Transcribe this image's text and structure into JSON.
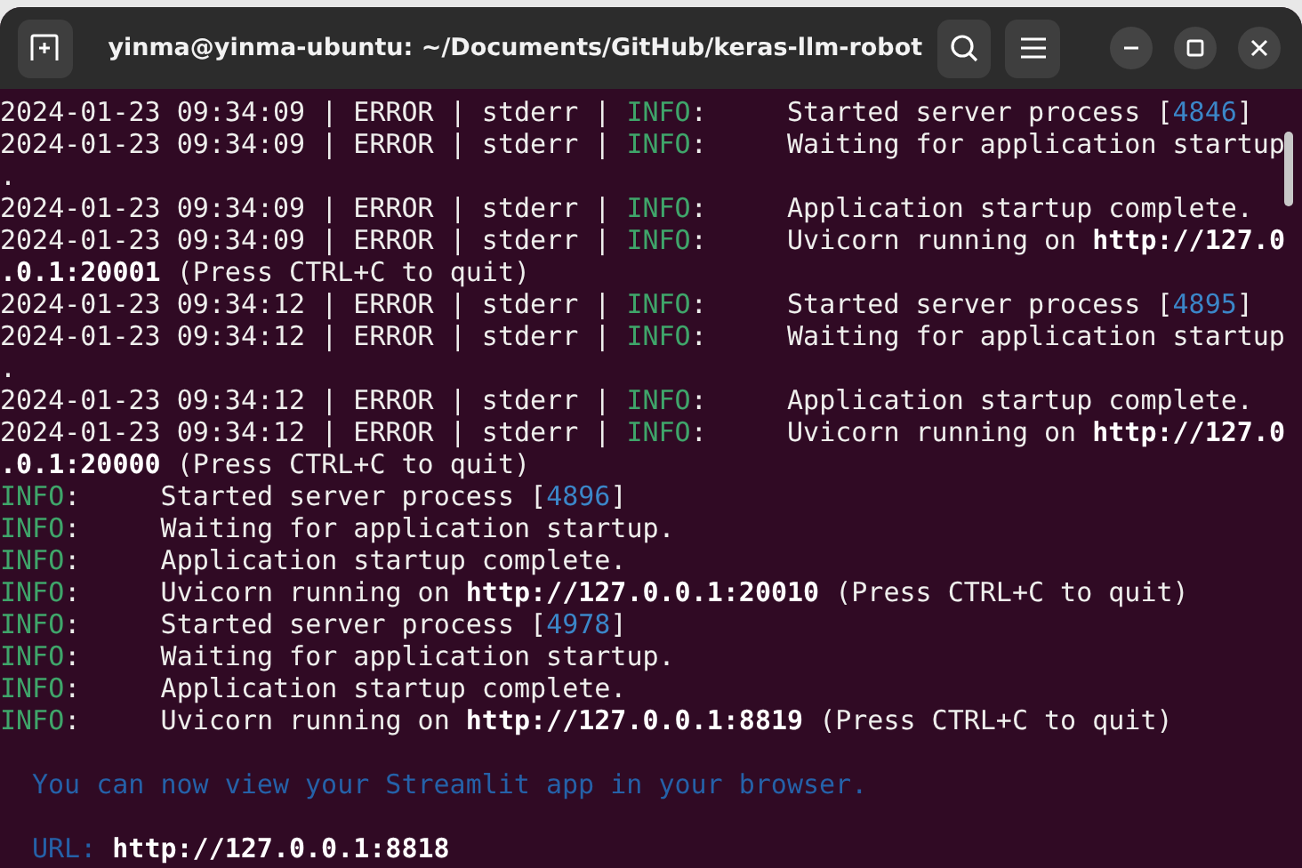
{
  "window": {
    "title": "yinma@yinma-ubuntu: ~/Documents/GitHub/keras-llm-robot"
  },
  "terminal": {
    "lines": [
      {
        "kind": "log",
        "segments": [
          {
            "kind": "text",
            "text": "2024-01-23 09:34:09 | ERROR | stderr | "
          },
          {
            "kind": "info",
            "text": "INFO"
          },
          {
            "kind": "text",
            "text": ":     Started server process ["
          },
          {
            "kind": "pid",
            "text": "4846"
          },
          {
            "kind": "text",
            "text": "]"
          }
        ]
      },
      {
        "kind": "log",
        "segments": [
          {
            "kind": "text",
            "text": "2024-01-23 09:34:09 | ERROR | stderr | "
          },
          {
            "kind": "info",
            "text": "INFO"
          },
          {
            "kind": "text",
            "text": ":     Waiting for application startup"
          }
        ]
      },
      {
        "kind": "log",
        "segments": [
          {
            "kind": "text",
            "text": "."
          }
        ]
      },
      {
        "kind": "log",
        "segments": [
          {
            "kind": "text",
            "text": "2024-01-23 09:34:09 | ERROR | stderr | "
          },
          {
            "kind": "info",
            "text": "INFO"
          },
          {
            "kind": "text",
            "text": ":     Application startup complete."
          }
        ]
      },
      {
        "kind": "log",
        "segments": [
          {
            "kind": "text",
            "text": "2024-01-23 09:34:09 | ERROR | stderr | "
          },
          {
            "kind": "info",
            "text": "INFO"
          },
          {
            "kind": "text",
            "text": ":     Uvicorn running on "
          },
          {
            "kind": "bold",
            "text": "http://127.0"
          }
        ]
      },
      {
        "kind": "log",
        "segments": [
          {
            "kind": "bold",
            "text": ".0.1:20001"
          },
          {
            "kind": "text",
            "text": " (Press CTRL+C to quit)"
          }
        ]
      },
      {
        "kind": "log",
        "segments": [
          {
            "kind": "text",
            "text": "2024-01-23 09:34:12 | ERROR | stderr | "
          },
          {
            "kind": "info",
            "text": "INFO"
          },
          {
            "kind": "text",
            "text": ":     Started server process ["
          },
          {
            "kind": "pid",
            "text": "4895"
          },
          {
            "kind": "text",
            "text": "]"
          }
        ]
      },
      {
        "kind": "log",
        "segments": [
          {
            "kind": "text",
            "text": "2024-01-23 09:34:12 | ERROR | stderr | "
          },
          {
            "kind": "info",
            "text": "INFO"
          },
          {
            "kind": "text",
            "text": ":     Waiting for application startup"
          }
        ]
      },
      {
        "kind": "log",
        "segments": [
          {
            "kind": "text",
            "text": "."
          }
        ]
      },
      {
        "kind": "log",
        "segments": [
          {
            "kind": "text",
            "text": "2024-01-23 09:34:12 | ERROR | stderr | "
          },
          {
            "kind": "info",
            "text": "INFO"
          },
          {
            "kind": "text",
            "text": ":     Application startup complete."
          }
        ]
      },
      {
        "kind": "log",
        "segments": [
          {
            "kind": "text",
            "text": "2024-01-23 09:34:12 | ERROR | stderr | "
          },
          {
            "kind": "info",
            "text": "INFO"
          },
          {
            "kind": "text",
            "text": ":     Uvicorn running on "
          },
          {
            "kind": "bold",
            "text": "http://127.0"
          }
        ]
      },
      {
        "kind": "log",
        "segments": [
          {
            "kind": "bold",
            "text": ".0.1:20000"
          },
          {
            "kind": "text",
            "text": " (Press CTRL+C to quit)"
          }
        ]
      },
      {
        "kind": "log",
        "segments": [
          {
            "kind": "info",
            "text": "INFO"
          },
          {
            "kind": "text",
            "text": ":     Started server process ["
          },
          {
            "kind": "pid",
            "text": "4896"
          },
          {
            "kind": "text",
            "text": "]"
          }
        ]
      },
      {
        "kind": "log",
        "segments": [
          {
            "kind": "info",
            "text": "INFO"
          },
          {
            "kind": "text",
            "text": ":     Waiting for application startup."
          }
        ]
      },
      {
        "kind": "log",
        "segments": [
          {
            "kind": "info",
            "text": "INFO"
          },
          {
            "kind": "text",
            "text": ":     Application startup complete."
          }
        ]
      },
      {
        "kind": "log",
        "segments": [
          {
            "kind": "info",
            "text": "INFO"
          },
          {
            "kind": "text",
            "text": ":     Uvicorn running on "
          },
          {
            "kind": "bold",
            "text": "http://127.0.0.1:20010"
          },
          {
            "kind": "text",
            "text": " (Press CTRL+C to quit)"
          }
        ]
      },
      {
        "kind": "log",
        "segments": [
          {
            "kind": "info",
            "text": "INFO"
          },
          {
            "kind": "text",
            "text": ":     Started server process ["
          },
          {
            "kind": "pid",
            "text": "4978"
          },
          {
            "kind": "text",
            "text": "]"
          }
        ]
      },
      {
        "kind": "log",
        "segments": [
          {
            "kind": "info",
            "text": "INFO"
          },
          {
            "kind": "text",
            "text": ":     Waiting for application startup."
          }
        ]
      },
      {
        "kind": "log",
        "segments": [
          {
            "kind": "info",
            "text": "INFO"
          },
          {
            "kind": "text",
            "text": ":     Application startup complete."
          }
        ]
      },
      {
        "kind": "log",
        "segments": [
          {
            "kind": "info",
            "text": "INFO"
          },
          {
            "kind": "text",
            "text": ":     Uvicorn running on "
          },
          {
            "kind": "bold",
            "text": "http://127.0.0.1:8819"
          },
          {
            "kind": "text",
            "text": " (Press CTRL+C to quit)"
          }
        ]
      },
      {
        "kind": "notice",
        "segments": [
          {
            "kind": "notice",
            "text": "You can now view your Streamlit app in your browser."
          }
        ]
      },
      {
        "kind": "notice",
        "segments": [
          {
            "kind": "label",
            "text": "URL:"
          },
          {
            "kind": "bold",
            "text": "http://127.0.0.1:8818"
          }
        ]
      }
    ]
  }
}
